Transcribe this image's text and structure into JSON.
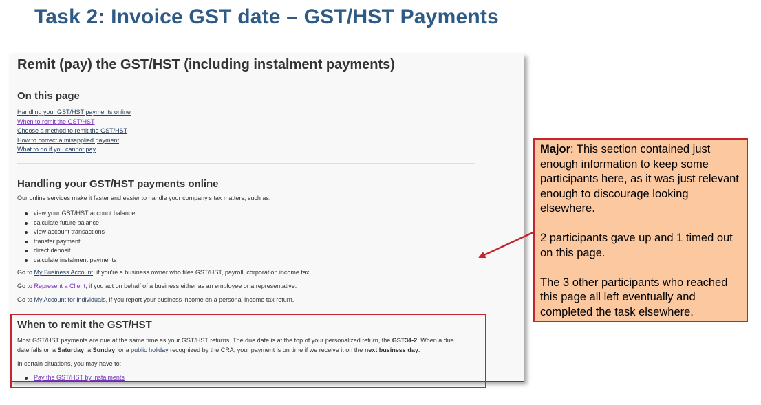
{
  "slide": {
    "title": "Task 2: Invoice GST date – GST/HST Payments"
  },
  "page": {
    "heading": "Remit (pay) the GST/HST (including instalment payments)",
    "on_this_page": {
      "heading": "On this page",
      "links": [
        "Handling your GST/HST payments online",
        "When to remit the GST/HST",
        "Choose a method to remit the GST/HST",
        "How to correct a misapplied payment",
        "What to do if you cannot pay"
      ]
    },
    "online": {
      "heading": "Handling your GST/HST payments online",
      "intro": "Our online services make it faster and easier to handle your company's tax matters, such as:",
      "bullets": [
        "view your GST/HST account balance",
        "calculate future balance",
        "view account transactions",
        "transfer payment",
        "direct deposit",
        "calculate instalment payments"
      ],
      "go1_prefix": "Go to ",
      "go1_link": "My Business Account",
      "go1_suffix": ", if you're a business owner who files GST/HST, payroll, corporation income tax.",
      "go2_prefix": "Go to ",
      "go2_link": "Represent a Client",
      "go2_suffix": ", if you act on behalf of a business either as an employee or a representative.",
      "go3_prefix": "Go to ",
      "go3_link": "My Account for individuals",
      "go3_suffix": ", if you report your business income on a personal income tax return."
    },
    "when": {
      "heading": "When to remit the GST/HST",
      "p1_a": "Most GST/HST payments are due at the same time as your GST/HST returns. The due date is at the top of your personalized return, the ",
      "p1_bold": "GST34-2",
      "p1_b": ". When a due",
      "p2_a": "date falls on a ",
      "p2_sat": "Saturday",
      "p2_b": ", a ",
      "p2_sun": "Sunday",
      "p2_c": ", or a ",
      "p2_link": "public holiday",
      "p2_d": " recognized by the CRA, your payment is on time if we receive it on the ",
      "p2_bold": "next business day",
      "p2_e": ".",
      "p3": "In certain situations, you may have to:",
      "bullet_link": "Pay the GST/HST by instalments"
    }
  },
  "callout": {
    "major_label": "Major",
    "para1": ": This section contained just enough information to keep some participants here, as it was just relevant enough to discourage looking elsewhere.",
    "para2": "2 participants gave up and 1 timed out on this page.",
    "para3": "The 3 other participants who reached this page all left eventually and completed the task elsewhere."
  },
  "colors": {
    "title_blue": "#2e5a86",
    "highlight_red": "#c1262d",
    "callout_fill": "#fbc8a0",
    "link_blue": "#284162",
    "link_visited": "#7834bc"
  }
}
